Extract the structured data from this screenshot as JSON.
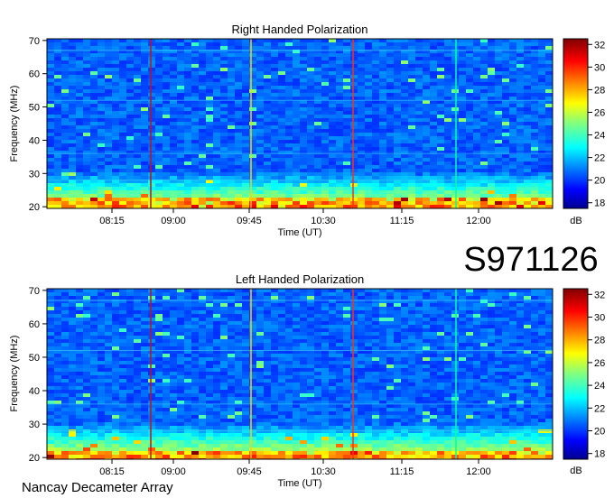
{
  "image_title": "S971126",
  "footer": "Nancay Decameter Array",
  "colors": {
    "vertical_lines": [
      "#c81010",
      "#ffd000",
      "#ff3010",
      "#00ffa0"
    ]
  },
  "chart_data": [
    {
      "type": "heatmap",
      "title": "Right Handed Polarization",
      "xlabel": "Time (UT)",
      "ylabel": "Frequency (MHz)",
      "x_ticks": [
        "08:15",
        "09:00",
        "09:45",
        "10:30",
        "11:15",
        "12:00"
      ],
      "y_ticks": [
        "20",
        "30",
        "40",
        "50",
        "60",
        "70"
      ],
      "ylim": [
        19.5,
        70.5
      ],
      "colorbar": {
        "ticks": [
          "32",
          "30",
          "28",
          "26",
          "24",
          "22",
          "20",
          "18"
        ],
        "range": [
          17.5,
          32.5
        ],
        "unit": "dB",
        "colormap": "jet"
      }
    },
    {
      "type": "heatmap",
      "title": "Left Handed Polarization",
      "xlabel": "Time (UT)",
      "ylabel": "Frequency (MHz)",
      "x_ticks": [
        "08:15",
        "09:00",
        "09:45",
        "10:30",
        "11:15",
        "12:00"
      ],
      "y_ticks": [
        "20",
        "30",
        "40",
        "50",
        "60",
        "70"
      ],
      "ylim": [
        19.5,
        70.5
      ],
      "colorbar": {
        "ticks": [
          "32",
          "30",
          "28",
          "26",
          "24",
          "22",
          "20",
          "18"
        ],
        "range": [
          17.5,
          32.5
        ],
        "unit": "dB",
        "colormap": "jet"
      }
    }
  ]
}
